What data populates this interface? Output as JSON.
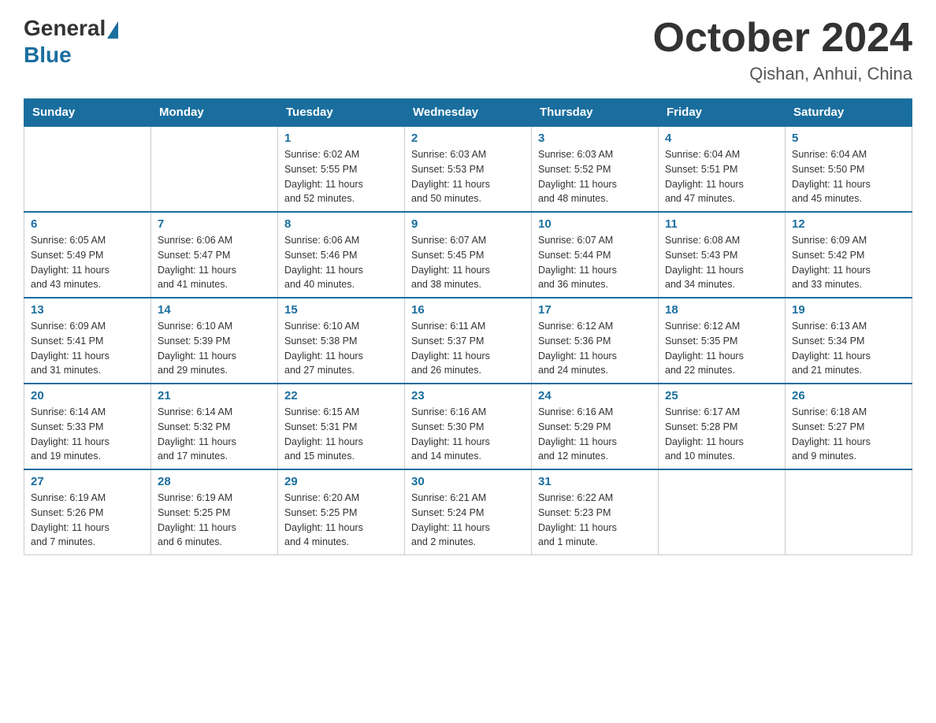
{
  "header": {
    "logo_general": "General",
    "logo_blue": "Blue",
    "title": "October 2024",
    "subtitle": "Qishan, Anhui, China"
  },
  "columns": [
    "Sunday",
    "Monday",
    "Tuesday",
    "Wednesday",
    "Thursday",
    "Friday",
    "Saturday"
  ],
  "weeks": [
    [
      {
        "day": "",
        "info": ""
      },
      {
        "day": "",
        "info": ""
      },
      {
        "day": "1",
        "info": "Sunrise: 6:02 AM\nSunset: 5:55 PM\nDaylight: 11 hours\nand 52 minutes."
      },
      {
        "day": "2",
        "info": "Sunrise: 6:03 AM\nSunset: 5:53 PM\nDaylight: 11 hours\nand 50 minutes."
      },
      {
        "day": "3",
        "info": "Sunrise: 6:03 AM\nSunset: 5:52 PM\nDaylight: 11 hours\nand 48 minutes."
      },
      {
        "day": "4",
        "info": "Sunrise: 6:04 AM\nSunset: 5:51 PM\nDaylight: 11 hours\nand 47 minutes."
      },
      {
        "day": "5",
        "info": "Sunrise: 6:04 AM\nSunset: 5:50 PM\nDaylight: 11 hours\nand 45 minutes."
      }
    ],
    [
      {
        "day": "6",
        "info": "Sunrise: 6:05 AM\nSunset: 5:49 PM\nDaylight: 11 hours\nand 43 minutes."
      },
      {
        "day": "7",
        "info": "Sunrise: 6:06 AM\nSunset: 5:47 PM\nDaylight: 11 hours\nand 41 minutes."
      },
      {
        "day": "8",
        "info": "Sunrise: 6:06 AM\nSunset: 5:46 PM\nDaylight: 11 hours\nand 40 minutes."
      },
      {
        "day": "9",
        "info": "Sunrise: 6:07 AM\nSunset: 5:45 PM\nDaylight: 11 hours\nand 38 minutes."
      },
      {
        "day": "10",
        "info": "Sunrise: 6:07 AM\nSunset: 5:44 PM\nDaylight: 11 hours\nand 36 minutes."
      },
      {
        "day": "11",
        "info": "Sunrise: 6:08 AM\nSunset: 5:43 PM\nDaylight: 11 hours\nand 34 minutes."
      },
      {
        "day": "12",
        "info": "Sunrise: 6:09 AM\nSunset: 5:42 PM\nDaylight: 11 hours\nand 33 minutes."
      }
    ],
    [
      {
        "day": "13",
        "info": "Sunrise: 6:09 AM\nSunset: 5:41 PM\nDaylight: 11 hours\nand 31 minutes."
      },
      {
        "day": "14",
        "info": "Sunrise: 6:10 AM\nSunset: 5:39 PM\nDaylight: 11 hours\nand 29 minutes."
      },
      {
        "day": "15",
        "info": "Sunrise: 6:10 AM\nSunset: 5:38 PM\nDaylight: 11 hours\nand 27 minutes."
      },
      {
        "day": "16",
        "info": "Sunrise: 6:11 AM\nSunset: 5:37 PM\nDaylight: 11 hours\nand 26 minutes."
      },
      {
        "day": "17",
        "info": "Sunrise: 6:12 AM\nSunset: 5:36 PM\nDaylight: 11 hours\nand 24 minutes."
      },
      {
        "day": "18",
        "info": "Sunrise: 6:12 AM\nSunset: 5:35 PM\nDaylight: 11 hours\nand 22 minutes."
      },
      {
        "day": "19",
        "info": "Sunrise: 6:13 AM\nSunset: 5:34 PM\nDaylight: 11 hours\nand 21 minutes."
      }
    ],
    [
      {
        "day": "20",
        "info": "Sunrise: 6:14 AM\nSunset: 5:33 PM\nDaylight: 11 hours\nand 19 minutes."
      },
      {
        "day": "21",
        "info": "Sunrise: 6:14 AM\nSunset: 5:32 PM\nDaylight: 11 hours\nand 17 minutes."
      },
      {
        "day": "22",
        "info": "Sunrise: 6:15 AM\nSunset: 5:31 PM\nDaylight: 11 hours\nand 15 minutes."
      },
      {
        "day": "23",
        "info": "Sunrise: 6:16 AM\nSunset: 5:30 PM\nDaylight: 11 hours\nand 14 minutes."
      },
      {
        "day": "24",
        "info": "Sunrise: 6:16 AM\nSunset: 5:29 PM\nDaylight: 11 hours\nand 12 minutes."
      },
      {
        "day": "25",
        "info": "Sunrise: 6:17 AM\nSunset: 5:28 PM\nDaylight: 11 hours\nand 10 minutes."
      },
      {
        "day": "26",
        "info": "Sunrise: 6:18 AM\nSunset: 5:27 PM\nDaylight: 11 hours\nand 9 minutes."
      }
    ],
    [
      {
        "day": "27",
        "info": "Sunrise: 6:19 AM\nSunset: 5:26 PM\nDaylight: 11 hours\nand 7 minutes."
      },
      {
        "day": "28",
        "info": "Sunrise: 6:19 AM\nSunset: 5:25 PM\nDaylight: 11 hours\nand 6 minutes."
      },
      {
        "day": "29",
        "info": "Sunrise: 6:20 AM\nSunset: 5:25 PM\nDaylight: 11 hours\nand 4 minutes."
      },
      {
        "day": "30",
        "info": "Sunrise: 6:21 AM\nSunset: 5:24 PM\nDaylight: 11 hours\nand 2 minutes."
      },
      {
        "day": "31",
        "info": "Sunrise: 6:22 AM\nSunset: 5:23 PM\nDaylight: 11 hours\nand 1 minute."
      },
      {
        "day": "",
        "info": ""
      },
      {
        "day": "",
        "info": ""
      }
    ]
  ]
}
